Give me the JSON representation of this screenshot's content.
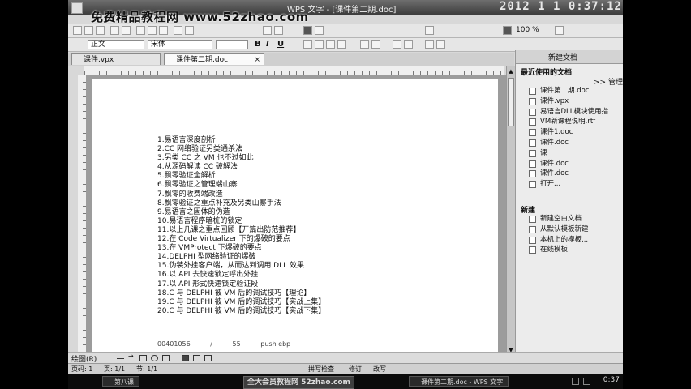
{
  "window": {
    "title": "WPS 文字 - [课件第二期.doc]",
    "clock": "2012 1 1 0:37:12",
    "watermark": "免费精品教程网 www.52zhao.com"
  },
  "toolbar": {
    "zoom": "100 %",
    "style_value": "正文",
    "font_value": "宋体",
    "bold": "B",
    "italic": "I",
    "underline": "U"
  },
  "tabs": [
    {
      "label": "课件.vpx"
    },
    {
      "label": "课件第二期.doc"
    }
  ],
  "document": {
    "lines": [
      "1.易语言深度剖析",
      "2.CC 网络验证另类通杀法",
      "3.另类 CC 之 VM 也不过如此",
      "4.从源码解读 CC 破解法",
      "5.飘零验证全解析",
      "6.飘零验证之管理端山寨",
      "7.飘零的收费端改造",
      "8.飘零验证之重点补充及另类山寨手法",
      "9.易语言之固体的伪造",
      "10.易语言程序暗桩的锁定",
      "11.以上几课之重点回顾【开篇出防范推荐】",
      "12.在 Code Virtualizer 下的爆破的要点",
      "13.在 VMProtect 下爆破的要点",
      "14.DELPHI 型网络验证的爆破",
      "15.伪装外挂客户端，从而达到调用 DLL 效果",
      "16.以 API 去快速锁定呼出外挂",
      "17.以 API 形式快速锁定验证段",
      "18.C 与 DELPHI 被 VM 后的调试技巧【理论】",
      "19.C 与 DELPHI 被 VM 后的调试技巧【实战上集】",
      "20.C 与 DELPHI 被 VM 后的调试技巧【实战下集】"
    ],
    "footer": [
      "00401056",
      "/",
      "55",
      "push ebp"
    ]
  },
  "taskpane": {
    "header": "新建文档",
    "recent_title": "最近使用的文档",
    "manage": ">> 管理",
    "recent": [
      "课件第二期.doc",
      "课件.vpx",
      "易语言DLL模块使用指",
      "VM新课程说明.rtf",
      "课件1.doc",
      "课件.doc",
      "课",
      "课件.doc",
      "课件.doc",
      "打开..."
    ],
    "new_title": "新建",
    "new_items": [
      "新建空白文档",
      "从默认模板新建",
      "本机上的模板...",
      "在线模板"
    ]
  },
  "drawbar": {
    "label": "绘图(R)"
  },
  "statusbar": {
    "page": "页码: 1",
    "pages": "页: 1/1",
    "section": "节: 1/1",
    "mode1": "修订",
    "mode2": "改写",
    "extra": "拼写检查"
  },
  "taskbar": {
    "items": [
      "第八课",
      "课件第二期.doc - WPS 文字"
    ],
    "banner": "全大会员教程网 52zhao.com",
    "time": "0:37"
  }
}
